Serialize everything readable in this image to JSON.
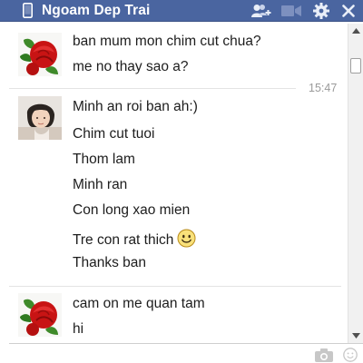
{
  "window": {
    "contact_name": "Ngoam Dep Trai",
    "header_color": "#4a65a0",
    "icons": [
      "phone-icon",
      "add-friend-icon",
      "video-call-icon",
      "gear-icon",
      "close-icon"
    ]
  },
  "conversation": {
    "groups": [
      {
        "sender": "friend",
        "avatar": "rose-avatar",
        "messages": [
          "ban mum mon chim cut chua?",
          "me no thay sao a?"
        ]
      },
      {
        "sender": "me",
        "avatar": "girl-avatar",
        "timestamp": "15:47",
        "messages": [
          "Minh an roi ban ah:)",
          "Chim cut tuoi",
          "Thom lam",
          "Minh ran",
          "Con long xao mien",
          "Tre con rat thich",
          "Thanks ban"
        ],
        "emoji_after_message": 5
      },
      {
        "sender": "friend",
        "avatar": "rose-avatar",
        "messages": [
          "cam on me quan tam",
          "hi"
        ]
      }
    ]
  },
  "composer": {
    "icons": [
      "camera-icon",
      "emoji-icon"
    ]
  }
}
